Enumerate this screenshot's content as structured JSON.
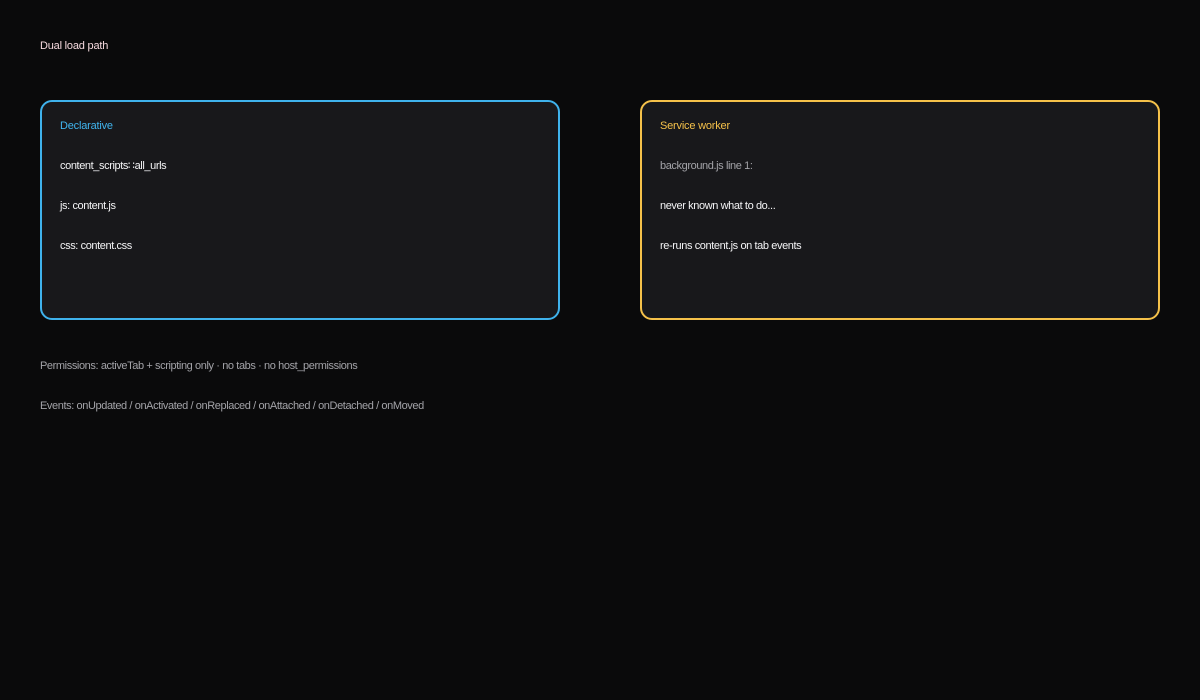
{
  "title": "Dual load path",
  "panels": {
    "declarative": {
      "title": "Declarative",
      "accent_color": "#3fb2ec",
      "lines": [
        "content_scripts∷all_urls",
        "js: content.js",
        "css: content.css"
      ]
    },
    "service_worker": {
      "title": "Service worker",
      "accent_color": "#f5c14a",
      "lines": [
        "background.js line 1:",
        "never known what to do...",
        "re-runs content.js on tab events"
      ]
    }
  },
  "footnotes": {
    "permissions": "Permissions: activeTab + scripting only · no tabs · no host_permissions",
    "events": "Events: onUpdated / onActivated / onReplaced / onAttached / onDetached / onMoved"
  }
}
